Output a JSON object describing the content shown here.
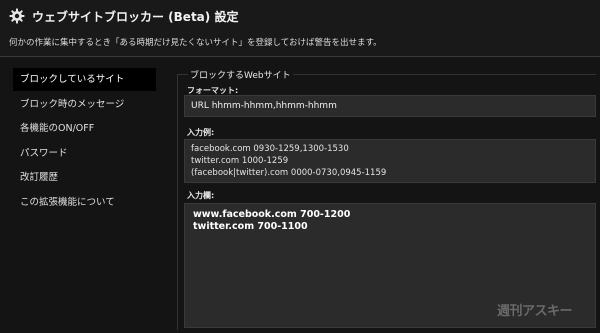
{
  "header": {
    "title": "ウェブサイトブロッカー (Beta) 設定",
    "subtitle": "何かの作業に集中するとき「ある時期だけ見たくないサイト」を登録しておけば警告を出せます。",
    "icon": "gear-icon"
  },
  "sidebar": {
    "items": [
      {
        "label": "ブロックしているサイト",
        "active": true
      },
      {
        "label": "ブロック時のメッセージ",
        "active": false
      },
      {
        "label": "各機能のON/OFF",
        "active": false
      },
      {
        "label": "パスワード",
        "active": false
      },
      {
        "label": "改訂履歴",
        "active": false
      },
      {
        "label": "この拡張機能について",
        "active": false
      }
    ]
  },
  "main": {
    "legend": "ブロックするWebサイト",
    "format_label": "フォーマット:",
    "format_value": "URL hhmm-hhmm,hhmm-hhmm",
    "example_label": "入力例:",
    "example_lines": [
      "facebook.com 0930-1259,1300-1530",
      "twitter.com 1000-1259",
      "(facebook|twitter).com 0000-0730,0945-1159"
    ],
    "input_label": "入力欄:",
    "input_lines": [
      "www.facebook.com 700-1200",
      "twitter.com 700-1100"
    ]
  },
  "watermark": "週刊アスキー",
  "colors": {
    "background": "#141414",
    "panel": "#2b2b2b",
    "active_nav": "#000000",
    "text": "#e8e8e8"
  }
}
